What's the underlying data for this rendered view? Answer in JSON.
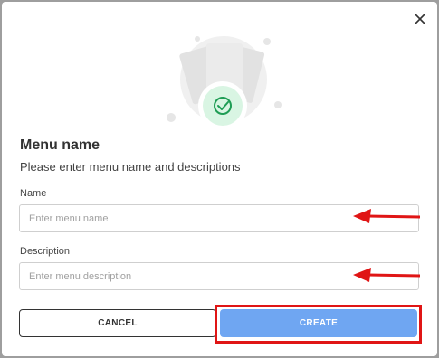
{
  "dialog": {
    "title": "Menu name",
    "subtitle": "Please enter menu name and descriptions"
  },
  "fields": {
    "name": {
      "label": "Name",
      "value": "",
      "placeholder": "Enter menu name"
    },
    "description": {
      "label": "Description",
      "value": "",
      "placeholder": "Enter menu description"
    }
  },
  "actions": {
    "cancel_label": "CANCEL",
    "create_label": "CREATE"
  },
  "icons": {
    "close": "close-icon",
    "illustration": "menu-check-illustration",
    "check": "check-circle-icon"
  },
  "colors": {
    "primary_button": "#6fa6f2",
    "annotation_red": "#e01515",
    "check_green": "#1f9d55"
  }
}
